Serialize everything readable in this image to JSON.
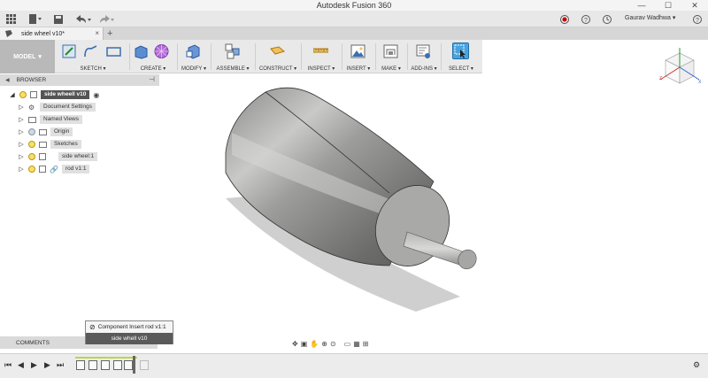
{
  "app": {
    "title": "Autodesk Fusion 360"
  },
  "window": {
    "minimize": "—",
    "maximize": "☐",
    "close": "✕"
  },
  "quickbar": {
    "user_name": "Gaurav Wadhwa",
    "user_chevron": "▾"
  },
  "tab": {
    "label": "side wheel v10*",
    "close": "×",
    "add": "+"
  },
  "ribbon": {
    "workspace": "MODEL",
    "groups": [
      {
        "label": "SKETCH ▾"
      },
      {
        "label": "CREATE ▾"
      },
      {
        "label": "MODIFY ▾"
      },
      {
        "label": "ASSEMBLE ▾"
      },
      {
        "label": "CONSTRUCT ▾"
      },
      {
        "label": "INSPECT ▾"
      },
      {
        "label": "INSERT ▾"
      },
      {
        "label": "MAKE ▾"
      },
      {
        "label": "ADD-INS ▾"
      },
      {
        "label": "SELECT ▾"
      }
    ]
  },
  "browser": {
    "title": "BROWSER",
    "items": [
      {
        "label": "side wheell v10"
      },
      {
        "label": "Document Settings"
      },
      {
        "label": "Named Views"
      },
      {
        "label": "Origin"
      },
      {
        "label": "Sketches"
      },
      {
        "label": "side wheel:1"
      },
      {
        "label": "rod v1:1"
      }
    ]
  },
  "comments": {
    "label": "COMMENTS"
  },
  "tooltip": {
    "line1": "Component Insert rod v1:1",
    "line2": "side whell v10"
  },
  "colors": {
    "accent_select": "#4aa3df",
    "model_btn": "#b9b9b9",
    "record": "#cc0000"
  }
}
